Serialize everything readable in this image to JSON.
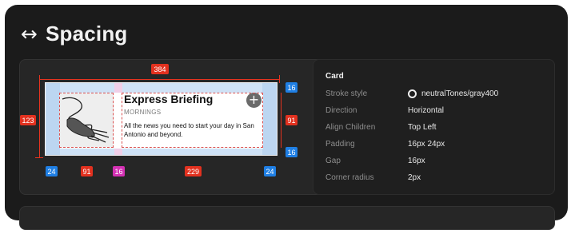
{
  "header": {
    "title": "Spacing",
    "icon": "left-right-arrow-icon"
  },
  "preview": {
    "card": {
      "title": "Express Briefing",
      "subtitle": "MORNINGS",
      "description": "All the news you need to start your day in San Antonio and beyond.",
      "add_icon": "plus-circle-icon"
    },
    "measurements": {
      "width": "384",
      "height": "123",
      "inner_height": "91",
      "padding_top": "16",
      "padding_bottom": "16",
      "padding_left": "24",
      "padding_right": "24",
      "image_width": "91",
      "gap": "16",
      "content_width": "229"
    }
  },
  "properties": {
    "heading": "Card",
    "rows": [
      {
        "key": "Stroke style",
        "value": "neutralTones/gray400"
      },
      {
        "key": "Direction",
        "value": "Horizontal"
      },
      {
        "key": "Align Children",
        "value": "Top Left"
      },
      {
        "key": "Padding",
        "value": "16px 24px"
      },
      {
        "key": "Gap",
        "value": "16px"
      },
      {
        "key": "Corner radius",
        "value": "2px"
      }
    ]
  },
  "colors": {
    "padding": "#cfe2f6",
    "gap": "#f0cfe8",
    "measure_red": "#e2311f",
    "measure_blue": "#1f7fe4",
    "measure_pink": "#d431b4"
  }
}
